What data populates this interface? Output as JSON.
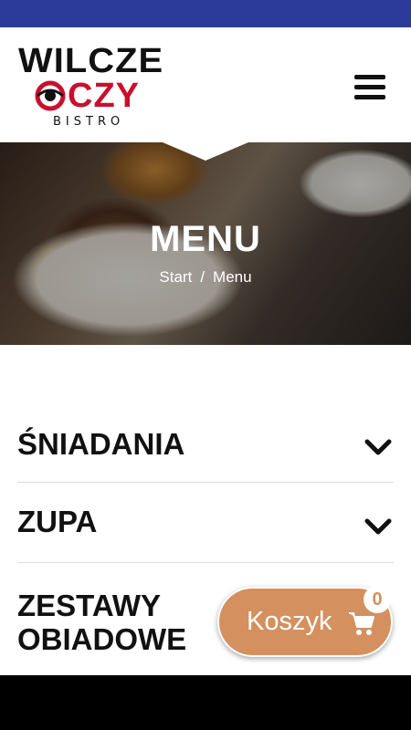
{
  "logo": {
    "line1": "WILCZE",
    "line2": "CZY",
    "line3": "BISTRO"
  },
  "hero": {
    "title": "MENU",
    "breadcrumb": [
      "Start",
      "/",
      "Menu"
    ]
  },
  "menu_categories": [
    {
      "label": "ŚNIADANIA",
      "icon": "chevron-down-icon"
    },
    {
      "label": "ZUPA",
      "icon": "chevron-down-icon"
    },
    {
      "label": "ZESTAWY OBIADOWE"
    }
  ],
  "cart": {
    "label": "Koszyk",
    "count": "0",
    "icon": "cart-icon"
  },
  "colors": {
    "status_bar": "#2c3b9a",
    "accent_red": "#c8102e",
    "cart_button": "#d4905e"
  }
}
